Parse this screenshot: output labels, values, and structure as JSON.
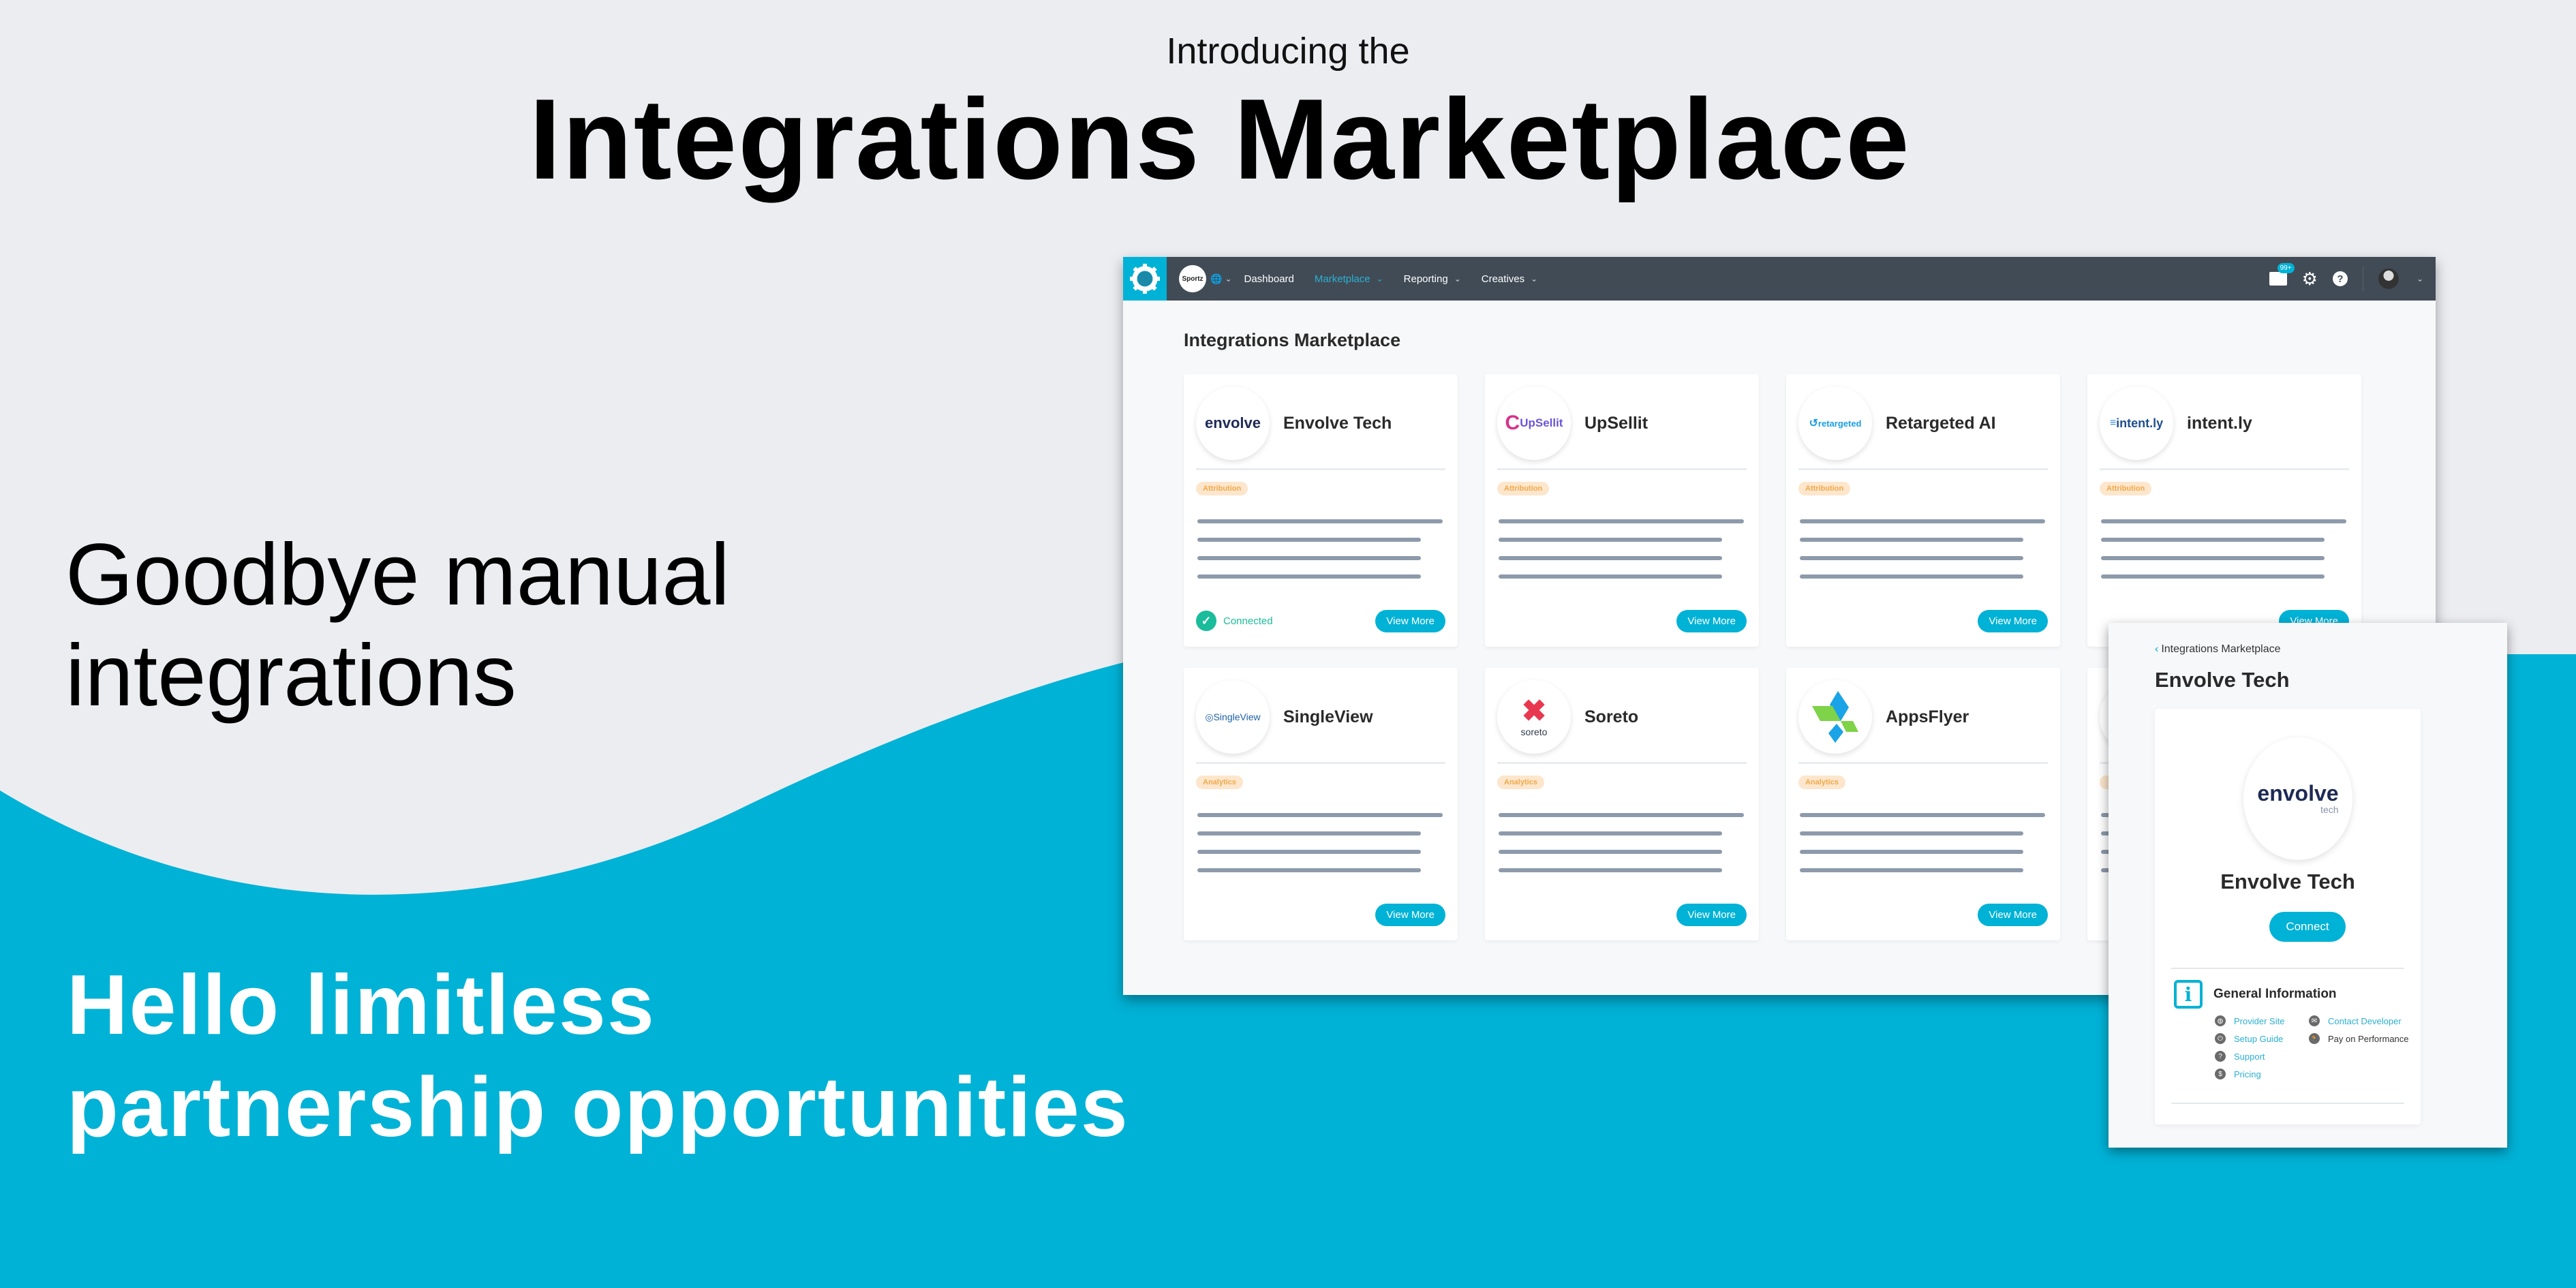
{
  "hero": {
    "intro": "Introducing the",
    "title": "Integrations Marketplace",
    "goodbye_line1": "Goodbye manual",
    "goodbye_line2": "integrations",
    "hello_line1": "Hello limitless",
    "hello_line2": "partnership opportunities"
  },
  "colors": {
    "accent": "#00b2d6",
    "background": "#ecedf1",
    "topbar": "#414b56",
    "connected": "#1abc9c",
    "tag_text": "#f0a94a",
    "tag_bg": "#fde6cc"
  },
  "app": {
    "brand": "Sportz",
    "nav": [
      {
        "label": "Dashboard",
        "active": false,
        "dropdown": false
      },
      {
        "label": "Marketplace",
        "active": true,
        "dropdown": true
      },
      {
        "label": "Reporting",
        "active": false,
        "dropdown": true
      },
      {
        "label": "Creatives",
        "active": false,
        "dropdown": true
      }
    ],
    "mail_badge": "99+",
    "page_title": "Integrations Marketplace",
    "view_more_label": "View More",
    "connected_label": "Connected",
    "cards": [
      {
        "name": "Envolve Tech",
        "logo_text": "envolve",
        "tag": "Attribution",
        "connected": true
      },
      {
        "name": "UpSellit",
        "logo_text": "UpSellit",
        "tag": "Attribution",
        "connected": false
      },
      {
        "name": "Retargeted AI",
        "logo_text": "retargeted",
        "tag": "Attribution",
        "connected": false
      },
      {
        "name": "intent.ly",
        "logo_text": "intent.ly",
        "tag": "Attribution",
        "connected": false
      },
      {
        "name": "SingleView",
        "logo_text": "SingleView",
        "tag": "Analytics",
        "connected": false
      },
      {
        "name": "Soreto",
        "logo_text": "soreto",
        "tag": "Analytics",
        "connected": false
      },
      {
        "name": "AppsFlyer",
        "logo_text": "",
        "tag": "Analytics",
        "connected": false
      }
    ]
  },
  "detail": {
    "breadcrumb": "Integrations Marketplace",
    "title": "Envolve Tech",
    "logo_text": "envolve",
    "logo_sub": "tech",
    "name": "Envolve Tech",
    "connect_label": "Connect",
    "info_title": "General Information",
    "links": [
      {
        "label": "Provider Site",
        "icon": "globe-icon",
        "link": true
      },
      {
        "label": "Setup Guide",
        "icon": "power-icon",
        "link": true
      },
      {
        "label": "Support",
        "icon": "question-icon",
        "link": true
      },
      {
        "label": "Pricing",
        "icon": "dollar-icon",
        "link": true
      },
      {
        "label": "Contact Developer",
        "icon": "mail-icon",
        "link": true
      },
      {
        "label": "Pay on Performance",
        "icon": "runner-icon",
        "link": false
      }
    ]
  }
}
